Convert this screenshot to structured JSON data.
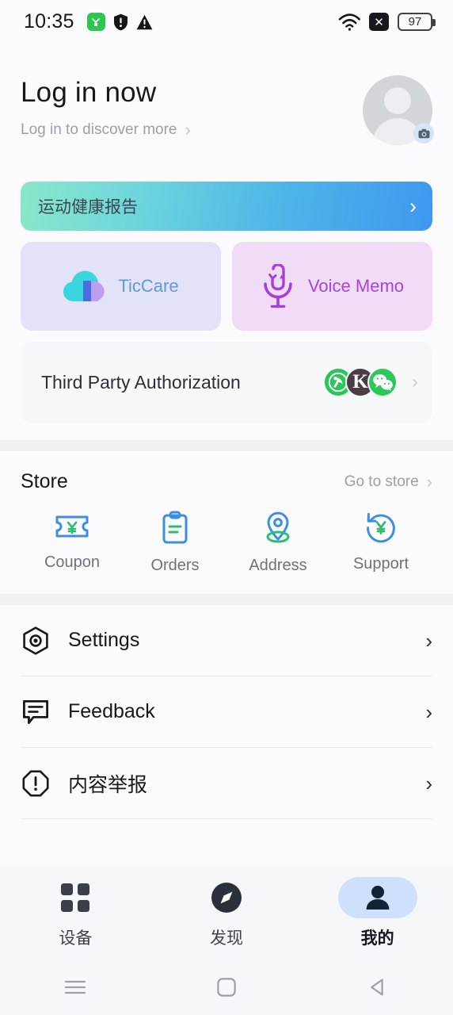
{
  "statusbar": {
    "time": "10:35",
    "icons": [
      "health-app-icon",
      "shield-icon",
      "warning-icon"
    ],
    "wifi": "wifi-icon",
    "nosim": "x-icon",
    "battery_percent": "97"
  },
  "header": {
    "title": "Log in now",
    "subtitle": "Log in to discover more",
    "chevron": "›",
    "avatar": "default-avatar",
    "camera_badge": "camera-icon"
  },
  "banner": {
    "label": "运动健康报告",
    "chevron": "›",
    "gradient_from": "#8ae8c8",
    "gradient_to": "#3f97ef"
  },
  "cards": [
    {
      "label": "TicCare",
      "icon": "cloud-icon",
      "bg": "#e2e2f9",
      "text_color": "#5e9ad8"
    },
    {
      "label": "Voice Memo",
      "icon": "microphone-icon",
      "bg": "#f1dcf7",
      "text_color": "#a545d8"
    }
  ],
  "third_party": {
    "label": "Third Party Authorization",
    "icons": [
      "health-icon",
      "keep-icon",
      "wechat-icon"
    ],
    "keep_letter": "K",
    "chevron": "›"
  },
  "store": {
    "title": "Store",
    "link_label": "Go to store",
    "link_chevron": "›",
    "items": [
      {
        "label": "Coupon",
        "icon": "coupon-ticket-icon"
      },
      {
        "label": "Orders",
        "icon": "clipboard-icon"
      },
      {
        "label": "Address",
        "icon": "location-pin-icon"
      },
      {
        "label": "Support",
        "icon": "refund-icon"
      }
    ]
  },
  "list": {
    "items": [
      {
        "label": "Settings",
        "icon": "gear-hex-icon",
        "chevron": "›"
      },
      {
        "label": "Feedback",
        "icon": "comment-icon",
        "chevron": "›"
      },
      {
        "label": "内容举报",
        "icon": "report-alert-icon",
        "chevron": "›"
      }
    ]
  },
  "tabbar": {
    "items": [
      {
        "label": "设备",
        "icon": "grid-icon",
        "active": false
      },
      {
        "label": "发现",
        "icon": "compass-icon",
        "active": false
      },
      {
        "label": "我的",
        "icon": "person-icon",
        "active": true
      }
    ],
    "active_pill_color": "#cfe0fb"
  },
  "navbar": {
    "items": [
      {
        "icon": "menu-icon"
      },
      {
        "icon": "home-square-icon"
      },
      {
        "icon": "back-triangle-icon"
      }
    ]
  }
}
